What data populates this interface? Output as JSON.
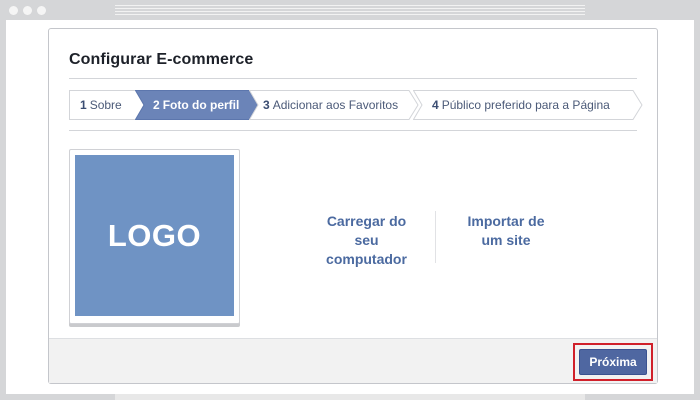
{
  "dialog": {
    "title": "Configurar E-commerce"
  },
  "steps": [
    {
      "number": "1",
      "label": "Sobre",
      "active": false
    },
    {
      "number": "2",
      "label": "Foto do perfil",
      "active": true
    },
    {
      "number": "3",
      "label": "Adicionar aos Favoritos",
      "active": false
    },
    {
      "number": "4",
      "label": "Público preferido para a Página",
      "active": false
    }
  ],
  "logo": {
    "text": "LOGO",
    "color": "#6f93c4"
  },
  "upload": {
    "line1": "Carregar do",
    "line2": "seu",
    "line3": "computador"
  },
  "import": {
    "line1": "Importar de",
    "line2": "um site"
  },
  "footer": {
    "next_label": "Próxima"
  },
  "colors": {
    "accent": "#4f67a1",
    "active_step": "#6b84b8",
    "highlight": "#d0202a"
  }
}
